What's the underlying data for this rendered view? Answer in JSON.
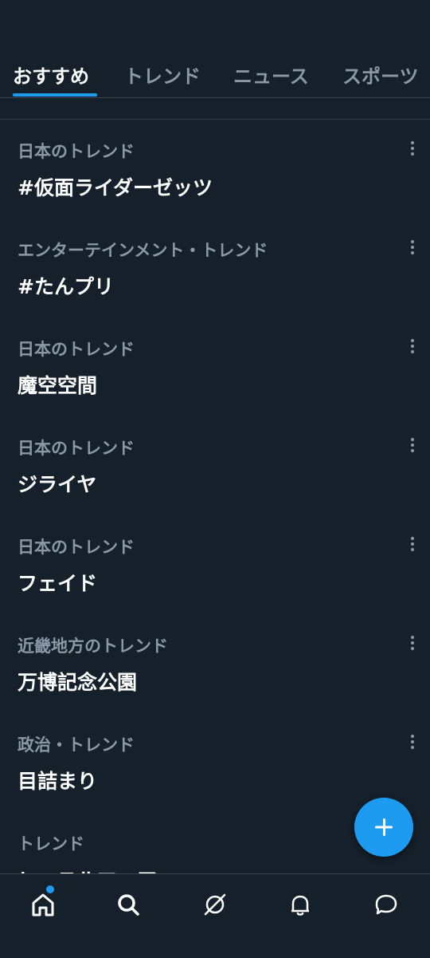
{
  "tabs": [
    {
      "label": "おすすめ",
      "active": true
    },
    {
      "label": "トレンド",
      "active": false
    },
    {
      "label": "ニュース",
      "active": false
    },
    {
      "label": "スポーツ",
      "active": false
    }
  ],
  "trends": [
    {
      "context": "日本のトレンド",
      "name": "#仮面ライダーゼッツ"
    },
    {
      "context": "エンターテインメント・トレンド",
      "name": "#たんプリ"
    },
    {
      "context": "日本のトレンド",
      "name": "魔空空間"
    },
    {
      "context": "日本のトレンド",
      "name": "ジライヤ"
    },
    {
      "context": "日本のトレンド",
      "name": "フェイド"
    },
    {
      "context": "近畿地方のトレンド",
      "name": "万博記念公園"
    },
    {
      "context": "政治・トレンド",
      "name": "目詰まり"
    },
    {
      "context": "トレンド",
      "name": "レッスルマニア"
    }
  ],
  "icons": {
    "more": "more-vertical-icon",
    "compose": "plus-icon",
    "nav": [
      "home-icon",
      "search-icon",
      "grok-icon",
      "bell-icon",
      "messages-icon"
    ]
  },
  "colors": {
    "background": "#15202b",
    "accent": "#1d9bf0",
    "secondary_text": "#8b98a5",
    "divider": "#38444d"
  }
}
